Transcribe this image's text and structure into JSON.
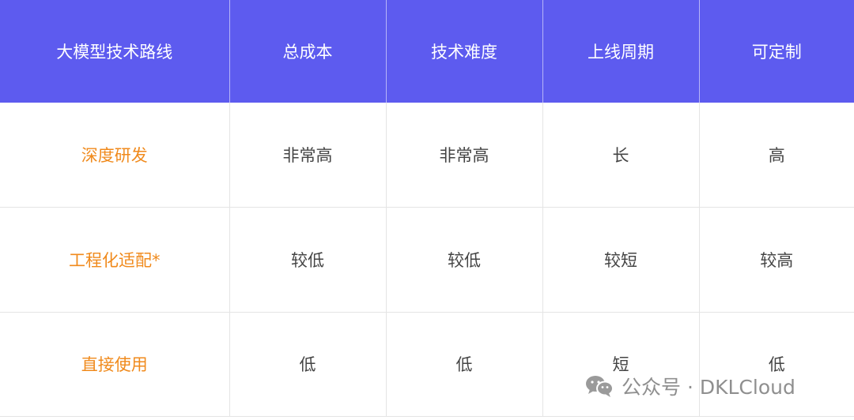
{
  "table": {
    "headers": [
      "大模型技术路线",
      "总成本",
      "技术难度",
      "上线周期",
      "可定制"
    ],
    "rows": [
      {
        "route": "深度研发",
        "cells": [
          "非常高",
          "非常高",
          "长",
          "高"
        ]
      },
      {
        "route": "工程化适配*",
        "cells": [
          "较低",
          "较低",
          "较短",
          "较高"
        ]
      },
      {
        "route": "直接使用",
        "cells": [
          "低",
          "低",
          "短",
          "低"
        ]
      }
    ]
  },
  "colors": {
    "header_bg": "#5d5bef",
    "header_text": "#ffffff",
    "route_text": "#f08a1c",
    "cell_text": "#444444"
  },
  "watermark": {
    "icon": "wechat-icon",
    "text": "公众号 · DKLCloud"
  }
}
